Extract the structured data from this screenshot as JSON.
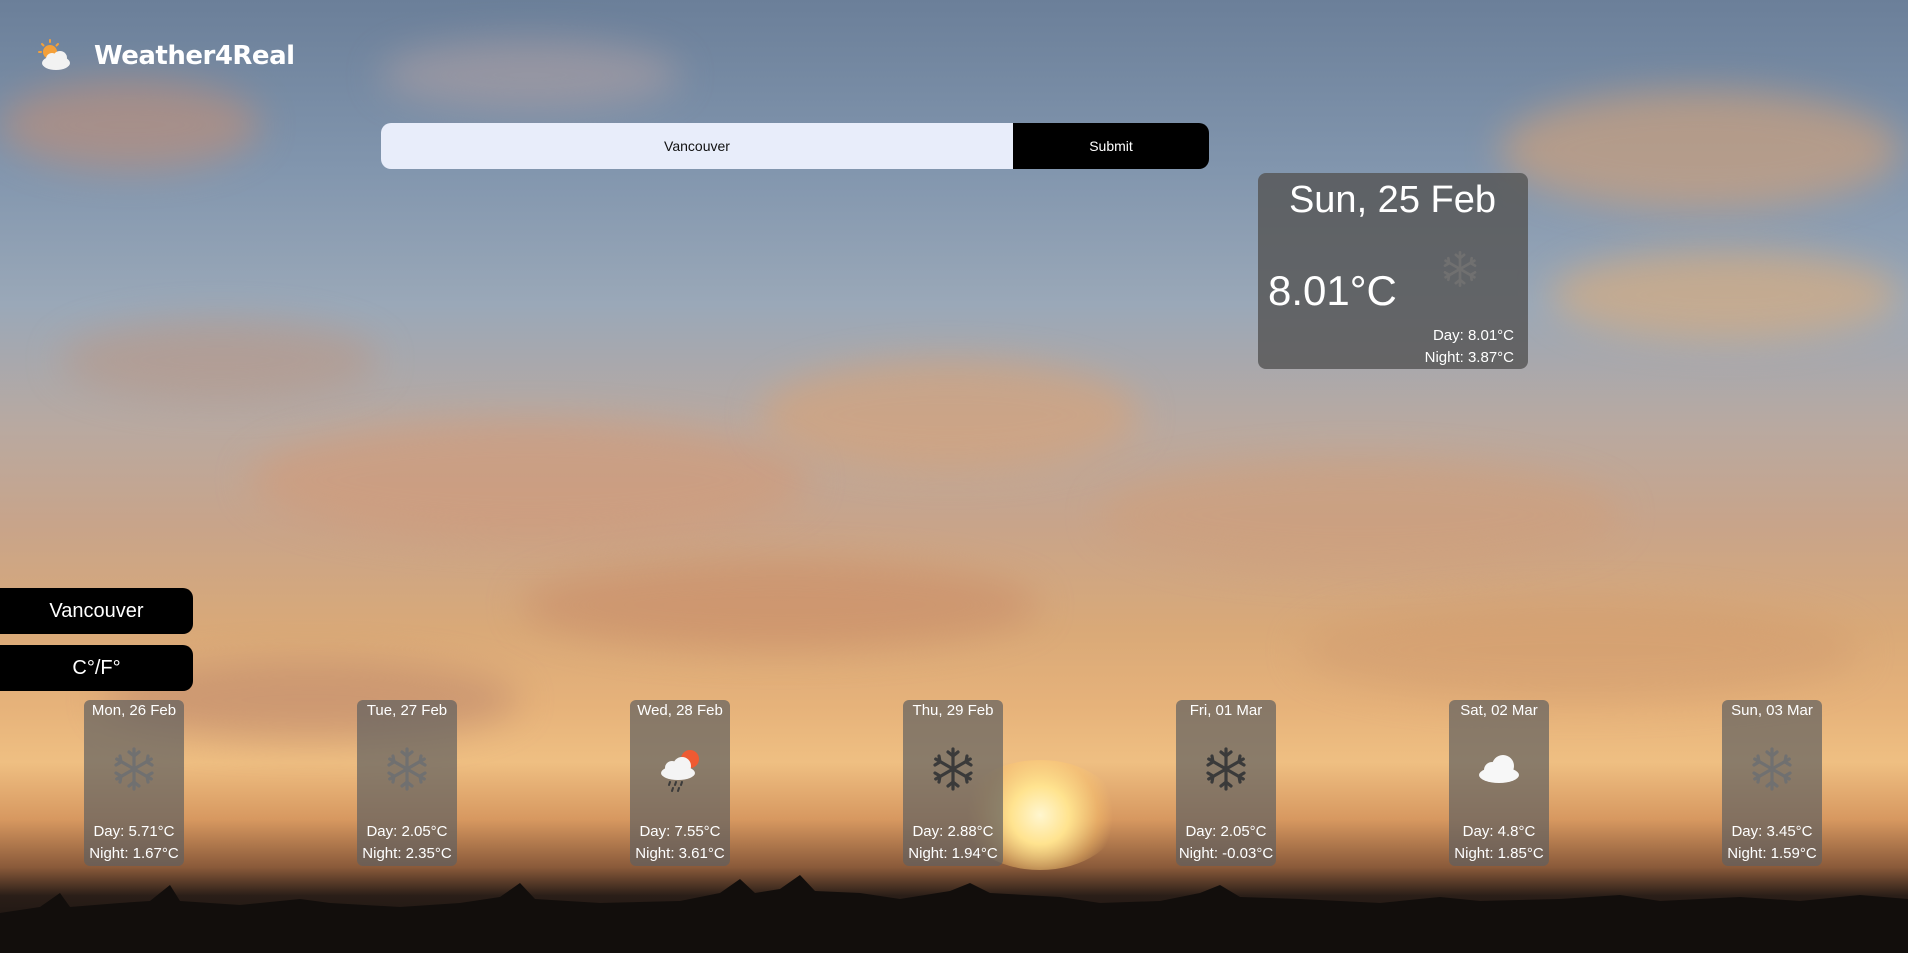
{
  "app": {
    "name": "Weather4Real",
    "logo_icon": "sun-behind-cloud-icon"
  },
  "search": {
    "value": "Vancouver",
    "submit_label": "Submit"
  },
  "current": {
    "date": "Sun, 25 Feb",
    "temp": "8.01°C",
    "icon": "snowflake-icon",
    "day": "Day: 8.01°C",
    "night": "Night: 3.87°C"
  },
  "sidebar": {
    "city_label": "Vancouver",
    "units_label": "C°/F°"
  },
  "forecast": [
    {
      "date": "Mon, 26 Feb",
      "icon": "snowflake-icon",
      "day": "Day: 5.71°C",
      "night": "Night: 1.67°C"
    },
    {
      "date": "Tue, 27 Feb",
      "icon": "snowflake-icon",
      "day": "Day: 2.05°C",
      "night": "Night: 2.35°C"
    },
    {
      "date": "Wed, 28 Feb",
      "icon": "rain-cloud-sun-icon",
      "day": "Day: 7.55°C",
      "night": "Night: 3.61°C"
    },
    {
      "date": "Thu, 29 Feb",
      "icon": "snowflake-icon",
      "day": "Day: 2.88°C",
      "night": "Night: 1.94°C"
    },
    {
      "date": "Fri, 01 Mar",
      "icon": "snowflake-icon",
      "day": "Day: 2.05°C",
      "night": "Night: -0.03°C"
    },
    {
      "date": "Sat, 02 Mar",
      "icon": "cloud-icon",
      "day": "Day: 4.8°C",
      "night": "Night: 1.85°C"
    },
    {
      "date": "Sun, 03 Mar",
      "icon": "snowflake-icon",
      "day": "Day: 3.45°C",
      "night": "Night: 1.59°C"
    }
  ],
  "colors": {
    "panel": "#555555",
    "button": "#000000",
    "input_bg": "#e8edfa",
    "text": "#ffffff"
  }
}
